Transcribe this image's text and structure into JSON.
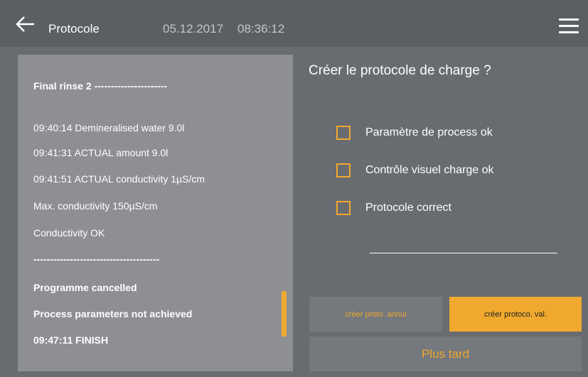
{
  "header": {
    "title": "Protocole",
    "date": "05.12.2017",
    "time": "08:36:12",
    "back_icon": "arrow-left-icon",
    "menu_icon": "hamburger-menu-icon"
  },
  "log": {
    "lines": [
      "Final rinse 2 ----------------------",
      "09:40:14 Demineralised water 9.0l",
      "09:41:31 ACTUAL amount 9.0l",
      "09:41:51 ACTUAL conductivity 1µS/cm",
      "Max. conductivity 150µS/cm",
      "Conductivity OK",
      "--------------------------------------",
      "Programme cancelled",
      "Process parameters not achieved",
      "09:47:11 FINISH"
    ]
  },
  "dialog": {
    "question": "Créer le protocole de charge ?",
    "checks": [
      {
        "label": "Paramètre de process ok",
        "checked": false
      },
      {
        "label": "Contrôle visuel charge ok",
        "checked": false
      },
      {
        "label": "Protocole correct",
        "checked": false
      }
    ]
  },
  "buttons": {
    "cancel_label": "créer proto. annul",
    "validate_label": "créer protoco. val.",
    "later_label": "Plus tard"
  },
  "colors": {
    "accent": "#f0a92e",
    "background": "#686b70",
    "header": "#5b5e62",
    "panel": "#8d8f93"
  }
}
